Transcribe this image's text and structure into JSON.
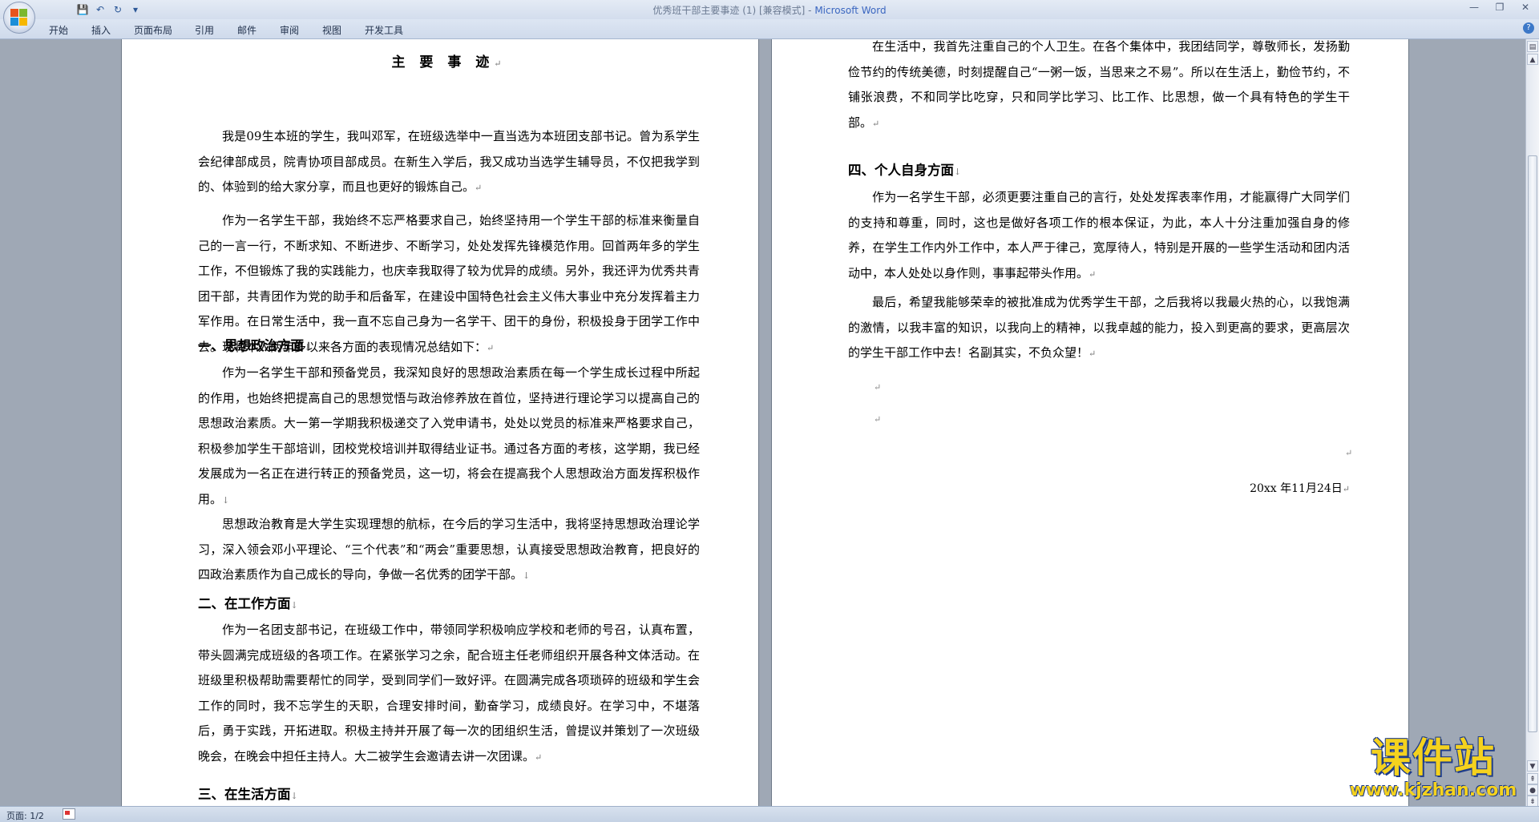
{
  "window": {
    "title_doc": "优秀班干部主要事迹 (1) [兼容模式] - ",
    "title_app": "Microsoft Word"
  },
  "ribbon": {
    "tabs": [
      "开始",
      "插入",
      "页面布局",
      "引用",
      "邮件",
      "审阅",
      "视图",
      "开发工具"
    ]
  },
  "page1": {
    "title": "主 要 事 迹",
    "intro1": "我是09生本班的学生，我叫邓军，在班级选举中一直当选为本班团支部书记。曾为系学生会纪律部成员，院青协项目部成员。在新生入学后，我又成功当选学生辅导员，不仅把我学到的、体验到的给大家分享，而且也更好的锻炼自己。",
    "intro2": "作为一名学生干部，我始终不忘严格要求自己，始终坚持用一个学生干部的标准来衡量自己的一言一行，不断求知、不断进步、不断学习，处处发挥先锋模范作用。回首两年多的学生工作，不但锻炼了我的实践能力，也庆幸我取得了较为优异的成绩。另外，我还评为优秀共青团干部，共青团作为党的助手和后备军，在建设中国特色社会主义伟大事业中充分发挥着主力军作用。在日常生活中，我一直不忘自己身为一名学干、团干的身份，积极投身于团学工作中去。现将本人两年多以来各方面的表现情况总结如下：",
    "h1": "一、思想政治方面",
    "p1": "作为一名学生干部和预备党员，我深知良好的思想政治素质在每一个学生成长过程中所起的作用，也始终把提高自己的思想觉悟与政治修养放在首位，坚持进行理论学习以提高自己的思想政治素质。大一第一学期我积极递交了入党申请书，处处以党员的标准来严格要求自己，积极参加学生干部培训，团校党校培训并取得结业证书。通过各方面的考核，这学期，我已经发展成为一名正在进行转正的预备党员，这一切，将会在提高我个人思想政治方面发挥积极作用。",
    "p2": "思想政治教育是大学生实现理想的航标，在今后的学习生活中，我将坚持思想政治理论学习，深入领会邓小平理论、“三个代表”和“两会”重要思想，认真接受思想政治教育，把良好的四政治素质作为自己成长的导向，争做一名优秀的团学干部。",
    "h2": "二、在工作方面",
    "p3": "作为一名团支部书记，在班级工作中，带领同学积极响应学校和老师的号召，认真布置，带头圆满完成班级的各项工作。在紧张学习之余，配合班主任老师组织开展各种文体活动。在班级里积极帮助需要帮忙的同学，受到同学们一致好评。在圆满完成各项琐碎的班级和学生会工作的同时，我不忘学生的天职，合理安排时间，勤奋学习，成绩良好。在学习中，不堪落后，勇于实践，开拓进取。积极主持并开展了每一次的团组织生活，曾提议并策划了一次班级晚会，在晚会中担任主持人。大二被学生会邀请去讲一次团课。",
    "h3": "三、在生活方面"
  },
  "page2": {
    "p4": "在生活中，我首先注重自己的个人卫生。在各个集体中，我团结同学，尊敬师长，发扬勤俭节约的传统美德，时刻提醒自己“一粥一饭，当思来之不易”。所以在生活上，勤俭节约，不铺张浪费，不和同学比吃穿，只和同学比学习、比工作、比思想，做一个具有特色的学生干部。",
    "h4": "四、个人自身方面",
    "p5": "作为一名学生干部，必须更要注重自己的言行，处处发挥表率作用，才能赢得广大同学们的支持和尊重，同时，这也是做好各项工作的根本保证，为此，本人十分注重加强自身的修养，在学生工作内外工作中，本人严于律己，宽厚待人，特别是开展的一些学生活动和团内活动中，本人处处以身作则，事事起带头作用。",
    "p6": "最后，希望我能够荣幸的被批准成为优秀学生干部，之后我将以我最火热的心，以我饱满的激情，以我丰富的知识，以我向上的精神，以我卓越的能力，投入到更高的要求，更高层次的学生干部工作中去！名副其实，不负众望！",
    "date": "20xx 年11月24日"
  },
  "marks": {
    "paragraph": "↵",
    "heading": "↓"
  },
  "statusbar": {
    "page_info": "页面: 1/2"
  },
  "watermark": {
    "title": "课件站",
    "url": "www.kjzhan.com"
  },
  "colors": {
    "app_title": "#3a66c0",
    "watermark": "#f5d21e",
    "watermark_outline": "#1e3c8a"
  }
}
